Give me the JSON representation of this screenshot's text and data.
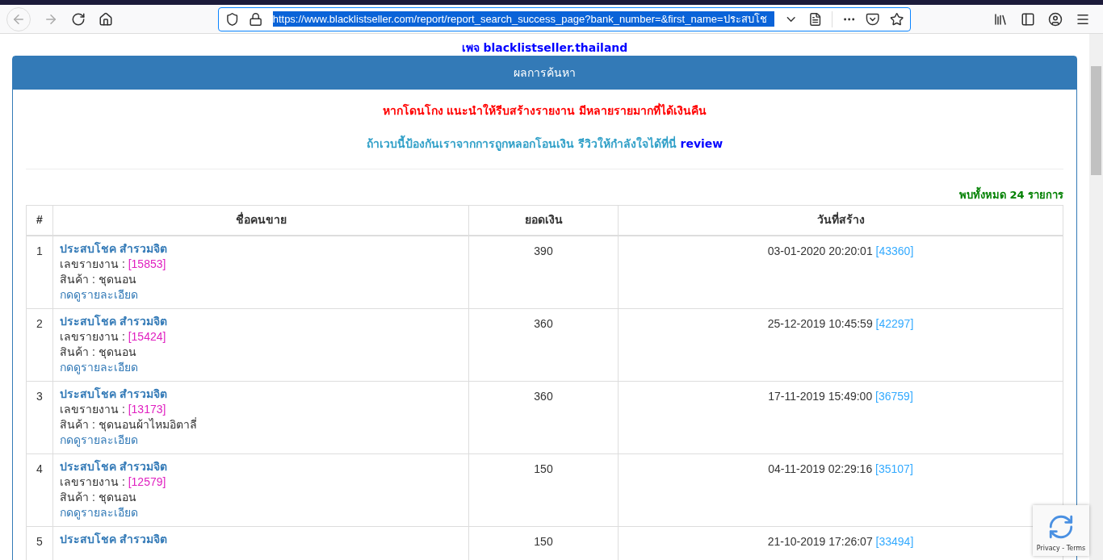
{
  "browser": {
    "url": "https://www.blacklistseller.com/report/report_search_success_page?bank_number=&first_name=ประสบโช"
  },
  "page_top_text": "เพจ blacklistseller.thailand",
  "panel": {
    "title": "ผลการค้นหา",
    "warning": "หากโดนโกง แนะนำให้รีบสร้างรายงาน มีหลายรายมากที่ได้เงินคืน",
    "review_text": "ถ้าเวบนี้ป้องกันเราจากการถูกหลอกโอนเงิน รีวิวให้กำลังใจได้ที่นี่",
    "review_link": "review",
    "count": "พบทั้งหมด **24** รายการ"
  },
  "table": {
    "columns": [
      "#",
      "ชื่อคนขาย",
      "ยอดเงิน",
      "วันที่สร้าง"
    ],
    "rows": [
      {
        "no": "1",
        "name": "ประสบโชค สำรวมจิต",
        "report_label": "เลขรายงาน :",
        "report_no": "[15853]",
        "product": "สินค้า : ชุดนอน",
        "detail": "กดดูรายละเอียด",
        "amount": "390",
        "date": "03-01-2020 20:20:01",
        "date_id": "[43360]"
      },
      {
        "no": "2",
        "name": "ประสบโชค สำรวมจิต",
        "report_label": "เลขรายงาน :",
        "report_no": "[15424]",
        "product": "สินค้า : ชุดนอน",
        "detail": "กดดูรายละเอียด",
        "amount": "360",
        "date": "25-12-2019 10:45:59",
        "date_id": "[42297]"
      },
      {
        "no": "3",
        "name": "ประสบโชค สำรวมจิต",
        "report_label": "เลขรายงาน :",
        "report_no": "[13173]",
        "product": "สินค้า : ชุดนอนผ้าไหมอิตาลี่",
        "detail": "กดดูรายละเอียด",
        "amount": "360",
        "date": "17-11-2019 15:49:00",
        "date_id": "[36759]"
      },
      {
        "no": "4",
        "name": "ประสบโชค สำรวมจิต",
        "report_label": "เลขรายงาน :",
        "report_no": "[12579]",
        "product": "สินค้า : ชุดนอน",
        "detail": "กดดูรายละเอียด",
        "amount": "150",
        "date": "04-11-2019 02:29:16",
        "date_id": "[35107]"
      },
      {
        "no": "5",
        "name": "ประสบโชค สำรวมจิต",
        "amount": "150",
        "date": "21-10-2019 17:26:07",
        "date_id": "[33494]"
      }
    ]
  },
  "recaptcha": {
    "links": "Privacy - Terms"
  }
}
